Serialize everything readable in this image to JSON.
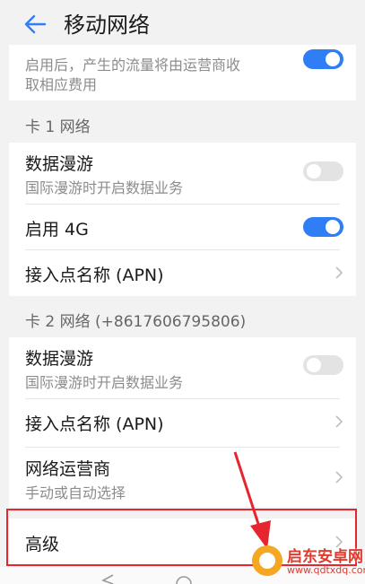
{
  "header": {
    "title": "移动网络"
  },
  "top_row": {
    "text_line1": "启用后，产生的流量将由运营商收",
    "text_line2": "取相应费用",
    "toggle_on": true
  },
  "sim1": {
    "section_title": "卡 1 网络",
    "roaming": {
      "title": "数据漫游",
      "subtitle": "国际漫游时开启数据业务",
      "toggle_on": false
    },
    "enable4g": {
      "title": "启用 4G",
      "toggle_on": true
    },
    "apn": {
      "title": "接入点名称 (APN)"
    }
  },
  "sim2": {
    "section_title": "卡 2 网络 (+8617606795806)",
    "roaming": {
      "title": "数据漫游",
      "subtitle": "国际漫游时开启数据业务",
      "toggle_on": false
    },
    "apn": {
      "title": "接入点名称 (APN)"
    },
    "operator": {
      "title": "网络运营商",
      "subtitle": "手动或自动选择"
    }
  },
  "advanced": {
    "title": "高级"
  },
  "watermark": {
    "name": "启东安卓网",
    "url": "www.qdtxdq.com"
  },
  "colors": {
    "accent": "#2f7ef6",
    "annotation": "#e5262e"
  },
  "icons": {
    "back": "arrow-left-icon",
    "chevron": "chevron-right-icon"
  }
}
